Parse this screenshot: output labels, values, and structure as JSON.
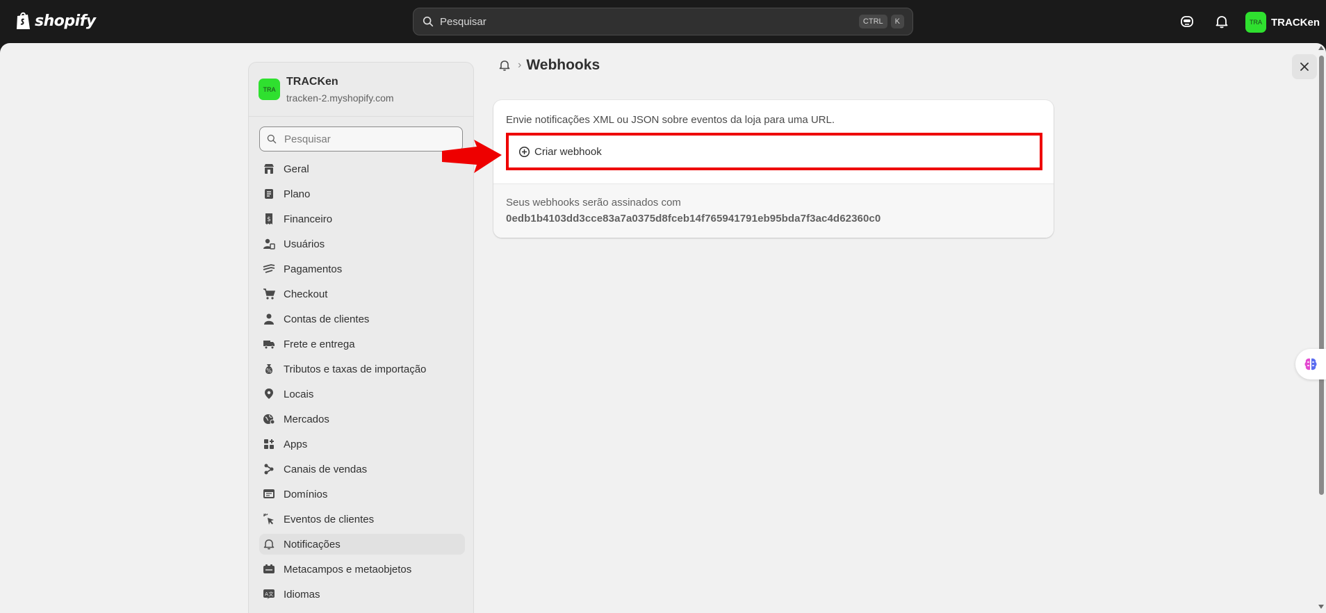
{
  "topbar": {
    "logo_text": "shopify",
    "search_placeholder": "Pesquisar",
    "shortcut_keys": [
      "CTRL",
      "K"
    ],
    "account_initials": "TRA",
    "account_name": "TRACKen"
  },
  "sidebar": {
    "store_initials": "TRA",
    "store_name": "TRACKen",
    "store_url": "tracken-2.myshopify.com",
    "search_placeholder": "Pesquisar",
    "items": [
      {
        "label": "Geral",
        "icon": "store-icon"
      },
      {
        "label": "Plano",
        "icon": "plan-icon"
      },
      {
        "label": "Financeiro",
        "icon": "receipt-icon"
      },
      {
        "label": "Usuários",
        "icon": "users-icon"
      },
      {
        "label": "Pagamentos",
        "icon": "payments-icon"
      },
      {
        "label": "Checkout",
        "icon": "cart-icon"
      },
      {
        "label": "Contas de clientes",
        "icon": "person-icon"
      },
      {
        "label": "Frete e entrega",
        "icon": "truck-icon"
      },
      {
        "label": "Tributos e taxas de importação",
        "icon": "money-bag-icon"
      },
      {
        "label": "Locais",
        "icon": "location-pin-icon"
      },
      {
        "label": "Mercados",
        "icon": "globe-icon"
      },
      {
        "label": "Apps",
        "icon": "apps-icon"
      },
      {
        "label": "Canais de vendas",
        "icon": "channels-icon"
      },
      {
        "label": "Domínios",
        "icon": "domain-icon"
      },
      {
        "label": "Eventos de clientes",
        "icon": "cursor-click-icon"
      },
      {
        "label": "Notificações",
        "icon": "bell-icon"
      },
      {
        "label": "Metacampos e metaobjetos",
        "icon": "metafields-icon"
      },
      {
        "label": "Idiomas",
        "icon": "language-icon"
      }
    ],
    "active_item": "Notificações"
  },
  "main": {
    "page_title": "Webhooks",
    "description": "Envie notificações XML ou JSON sobre eventos da loja para uma URL.",
    "create_button_label": "Criar webhook",
    "signed_text": "Seus webhooks serão assinados com",
    "signature": "0edb1b4103dd3cce83a7a0375d8fceb14f765941791eb95bda7f3ac4d62360c0"
  },
  "colors": {
    "topbar_bg": "#1a1a1a",
    "avatar_green": "#2fe02f",
    "highlight_red": "#ee0000",
    "page_bg": "#f1f1f1"
  }
}
